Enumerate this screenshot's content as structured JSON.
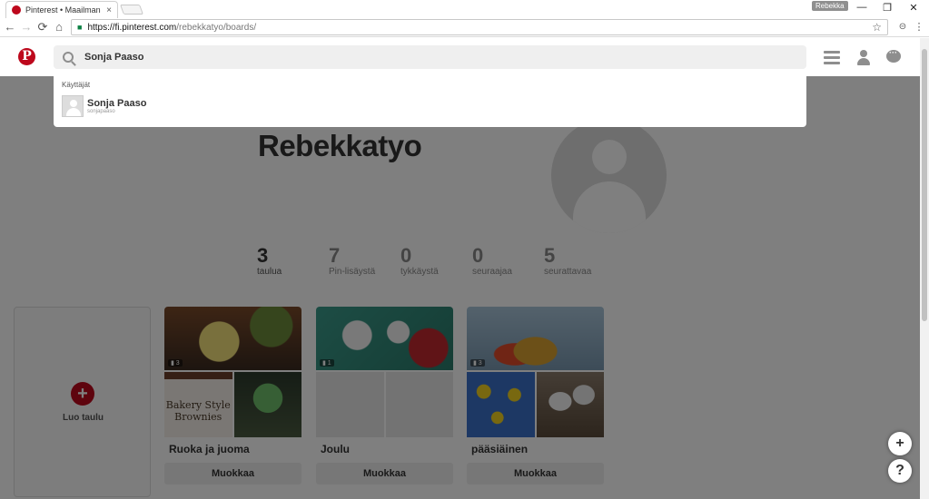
{
  "browser": {
    "tab_title": "Pinterest • Maailman kä",
    "tab_close": "×",
    "profile_chip": "Rebekka",
    "url_host": "https://fi.pinterest.com",
    "url_path": "/rebekkatyo/boards/",
    "controls": {
      "minimize": "—",
      "maximize": "❐",
      "close": "✕"
    },
    "nav": {
      "back": "←",
      "forward": "→",
      "reload": "⟳",
      "home": "⌂"
    },
    "star": "☆"
  },
  "header": {
    "logo": "P",
    "search_value": "Sonja Paaso"
  },
  "dropdown": {
    "section_label": "Käyttäjät",
    "results": [
      {
        "name": "Sonja Paaso",
        "username": "sonjapaaso"
      }
    ]
  },
  "profile": {
    "name": "Rebekkatyo",
    "stats": [
      {
        "num": "3",
        "label": "taulua"
      },
      {
        "num": "7",
        "label": "Pin-lisäystä"
      },
      {
        "num": "0",
        "label": "tykkäystä"
      },
      {
        "num": "0",
        "label": "seuraajaa"
      },
      {
        "num": "5",
        "label": "seurattavaa"
      }
    ]
  },
  "create_board": {
    "plus": "+",
    "label": "Luo taulu"
  },
  "boards": [
    {
      "title": "Ruoka ja juoma",
      "pin_count": "3",
      "edit_label": "Muokkaa",
      "thumb_text": "Bakery Style Brownies"
    },
    {
      "title": "Joulu",
      "pin_count": "1",
      "edit_label": "Muokkaa"
    },
    {
      "title": "pääsiäinen",
      "pin_count": "3",
      "edit_label": "Muokkaa"
    }
  ],
  "fab": {
    "add": "+",
    "help": "?"
  },
  "colors": {
    "brand": "#bd081c",
    "overlay": "rgba(0,0,0,0.5)"
  }
}
